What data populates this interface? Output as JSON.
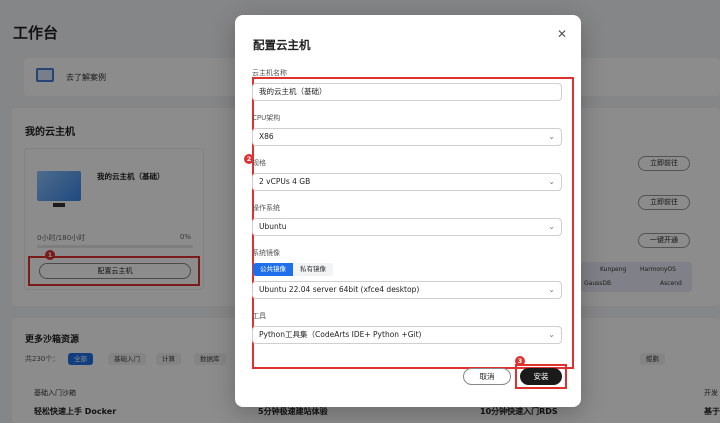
{
  "background": {
    "title": "工作台",
    "banner_text": "去了解案例",
    "my_host_title": "我的云主机",
    "host_name": "我的云主机（基础）",
    "usage": "0小时/180小时",
    "usage_percent": "0%",
    "usage_fraction": 0,
    "configure_button": "配置云主机",
    "pill_go_1": "立即前往",
    "pill_go_2": "立即前往",
    "pill_open": "一键开通",
    "brands": [
      "Kunpeng",
      "HarmonyOS",
      "GaussDB",
      "Ascend"
    ],
    "more_title": "更多沙箱资源",
    "count": "共230个：",
    "filter_tabs": [
      "全部",
      "基础入门",
      "计算",
      "数据库"
    ],
    "filter_tab_right": "鲲鹏",
    "column_head_1": "基础入门沙箱",
    "column_head_2": "开发",
    "course_titles": [
      "轻松快速上手 Docker",
      "5分钟极速建站体验",
      "10分钟快速入门RDS",
      "基于"
    ]
  },
  "dialog": {
    "title": "配置云主机",
    "fields": {
      "name_label": "云主机名称",
      "name_value": "我的云主机（基础）",
      "cpu_label": "CPU架构",
      "cpu_value": "X86",
      "spec_label": "规格",
      "spec_value": "2 vCPUs 4 GB",
      "os_label": "操作系统",
      "os_value": "Ubuntu",
      "image_label": "系统镜像",
      "image_tab_public": "公共镜像",
      "image_tab_private": "私有镜像",
      "image_value": "Ubuntu 22.04 server 64bit (xfce4 desktop)",
      "tool_label": "工具",
      "tool_value": "Python工具集（CodeArts IDE+ Python +Git)"
    },
    "cancel_label": "取消",
    "install_label": "安装",
    "badges": [
      "1",
      "2",
      "3"
    ]
  },
  "colors": {
    "accent": "#1f6feb",
    "highlight": "#e03131"
  }
}
